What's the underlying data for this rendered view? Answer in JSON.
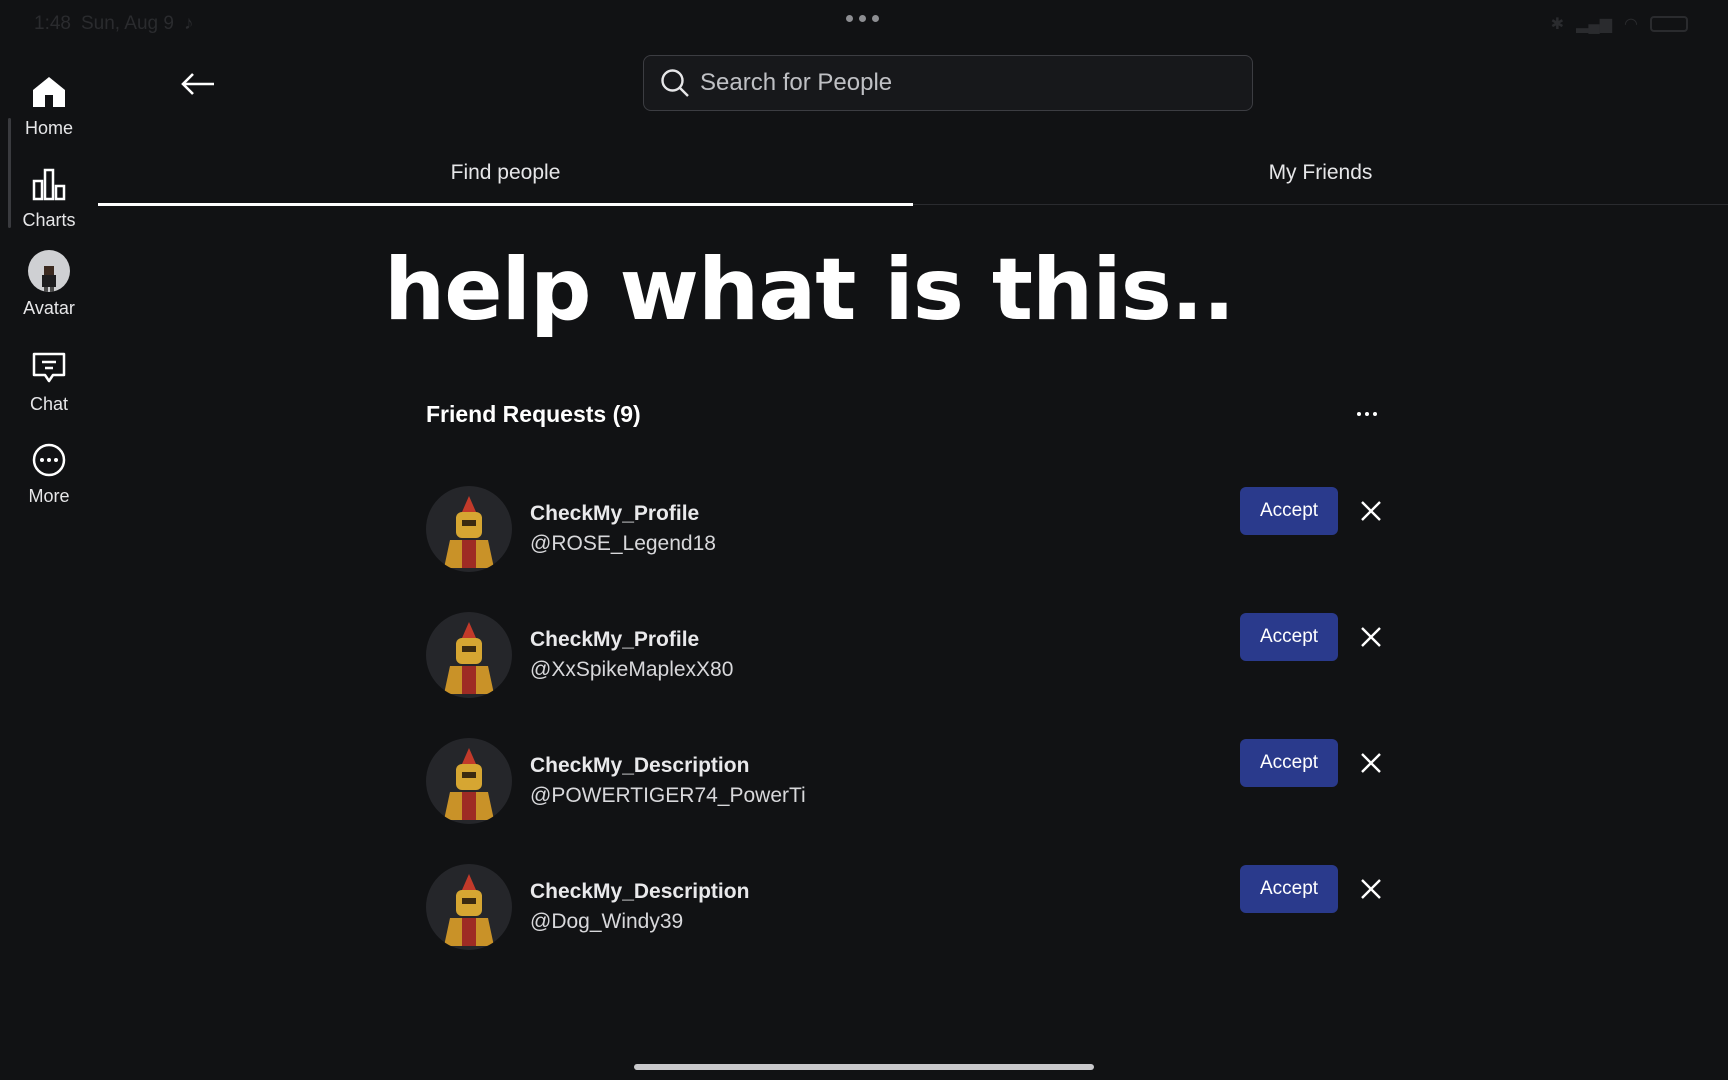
{
  "status_bar": {
    "time": "1:48",
    "date": "Sun, Aug 9"
  },
  "sidebar": {
    "items": [
      {
        "label": "Home"
      },
      {
        "label": "Charts"
      },
      {
        "label": "Avatar"
      },
      {
        "label": "Chat"
      },
      {
        "label": "More"
      }
    ]
  },
  "search": {
    "placeholder": "Search for People"
  },
  "tabs": [
    {
      "label": "Find people",
      "active": true
    },
    {
      "label": "My Friends",
      "active": false
    }
  ],
  "overlay_caption": "help what is this..",
  "friend_requests": {
    "title": "Friend Requests (9)",
    "accept_label": "Accept",
    "items": [
      {
        "display_name": "CheckMy_Profile",
        "username": "@ROSE_Legend18"
      },
      {
        "display_name": "CheckMy_Profile",
        "username": "@XxSpikeMaplexX80"
      },
      {
        "display_name": "CheckMy_Description",
        "username": "@POWERTIGER74_PowerTi"
      },
      {
        "display_name": "CheckMy_Description",
        "username": "@Dog_Windy39"
      }
    ]
  },
  "colors": {
    "background": "#111214",
    "accent_button": "#2a3a8c",
    "text": "#ffffff"
  }
}
